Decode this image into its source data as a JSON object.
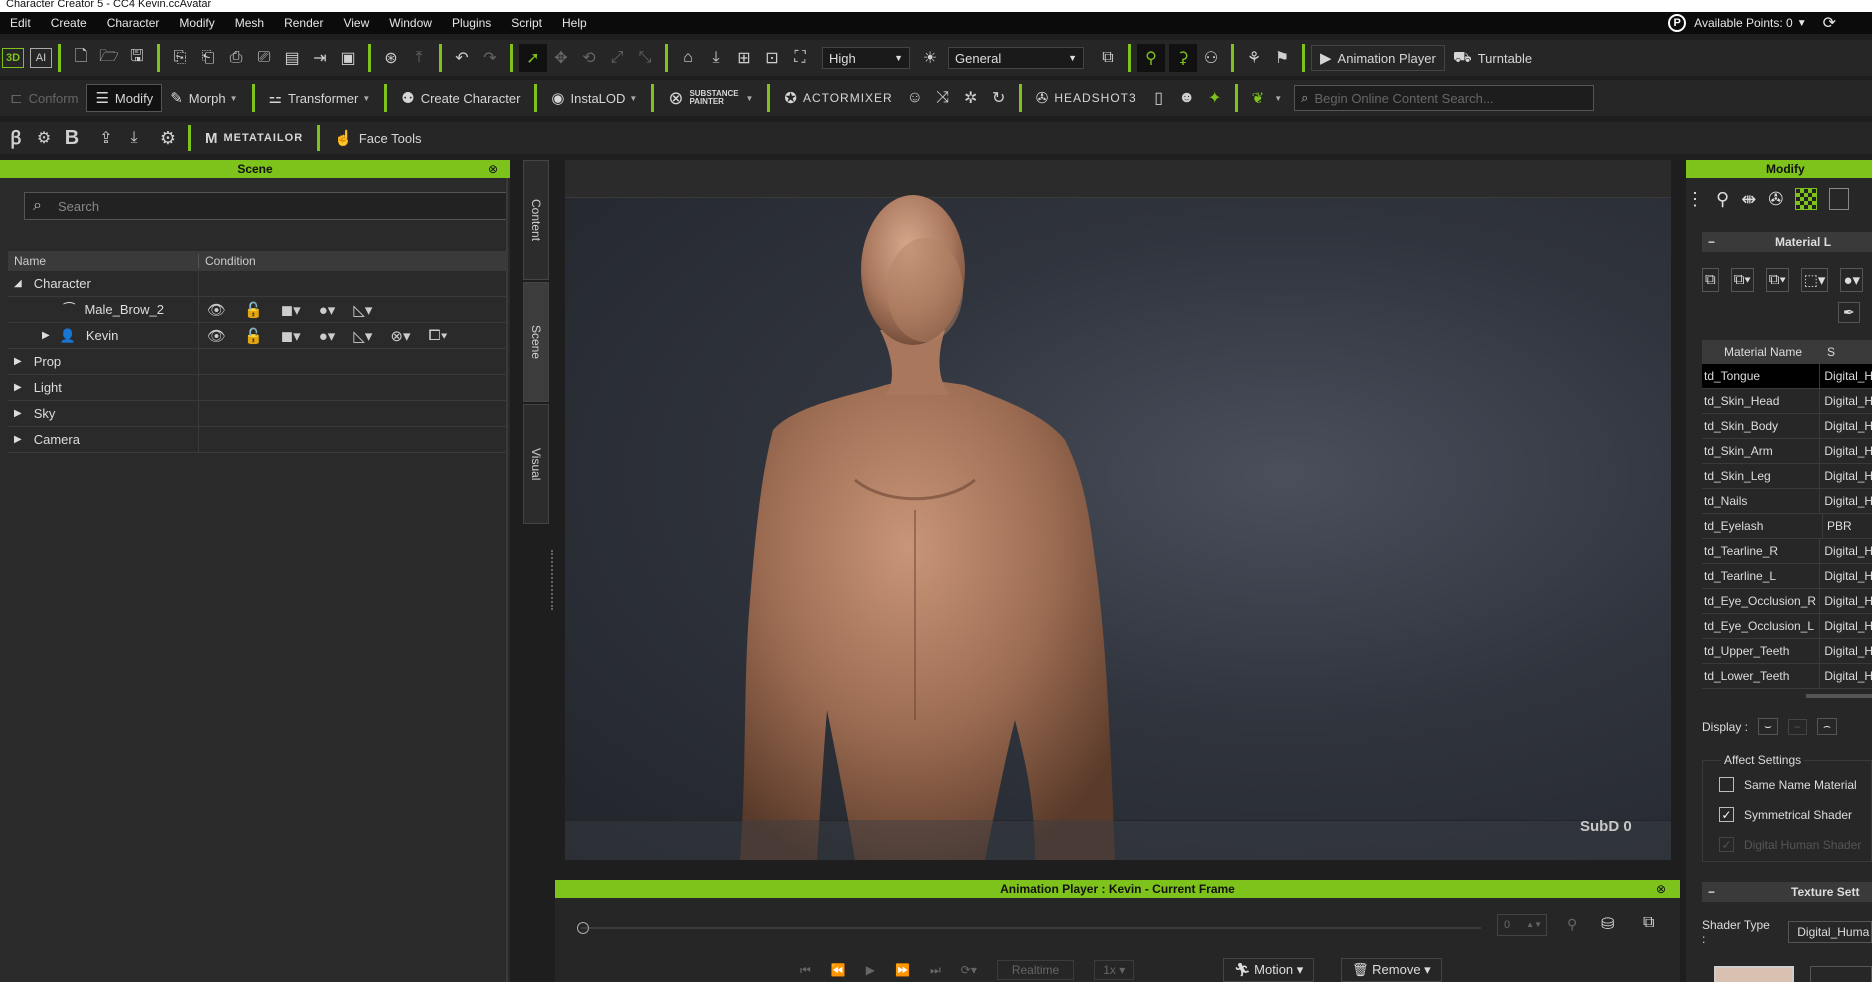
{
  "titlebar": {
    "text": "Character Creator 5 - CC4 Kevin.ccAvatar"
  },
  "menu": [
    "Edit",
    "Create",
    "Character",
    "Modify",
    "Mesh",
    "Render",
    "View",
    "Window",
    "Plugins",
    "Script",
    "Help"
  ],
  "account": {
    "points_label": "Available Points: 0"
  },
  "toolbar1": {
    "quality": "High",
    "render_mode": "General",
    "animation_player": "Animation Player",
    "turntable": "Turntable"
  },
  "toolbar2": {
    "conform": "Conform",
    "modify": "Modify",
    "morph": "Morph",
    "transformer": "Transformer",
    "create_character": "Create Character",
    "instalod": "InstaLOD",
    "substance": "SUBSTANCE PAINTER",
    "actormixer": "ACTORMIXER",
    "headshot": "HEADSHOT3",
    "search_placeholder": "Begin Online Content Search..."
  },
  "toolbar3": {
    "metatailor": "METATAILOR",
    "face_tools": "Face Tools"
  },
  "scene": {
    "title": "Scene",
    "search_placeholder": "Search",
    "col_name": "Name",
    "col_condition": "Condition",
    "rows": [
      {
        "name": "Character"
      },
      {
        "name": "Male_Brow_2"
      },
      {
        "name": "Kevin"
      },
      {
        "name": "Prop"
      },
      {
        "name": "Light"
      },
      {
        "name": "Sky"
      },
      {
        "name": "Camera"
      }
    ]
  },
  "side_tabs": [
    "Content",
    "Scene",
    "Visual"
  ],
  "viewport": {
    "subd": "SubD 0"
  },
  "anim": {
    "title": "Animation Player : Kevin - Current Frame",
    "frame": "0",
    "realtime": "Realtime",
    "speed": "1x",
    "motion": "Motion",
    "remove": "Remove"
  },
  "modify": {
    "title": "Modify",
    "material_header": "Material L",
    "col_material": "Material Name",
    "col_shader": "S",
    "materials": [
      {
        "name": "td_Tongue",
        "shader": "Digital_H"
      },
      {
        "name": "td_Skin_Head",
        "shader": "Digital_H"
      },
      {
        "name": "td_Skin_Body",
        "shader": "Digital_H"
      },
      {
        "name": "td_Skin_Arm",
        "shader": "Digital_H"
      },
      {
        "name": "td_Skin_Leg",
        "shader": "Digital_H"
      },
      {
        "name": "td_Nails",
        "shader": "Digital_H"
      },
      {
        "name": "td_Eyelash",
        "shader": "PBR"
      },
      {
        "name": "td_Tearline_R",
        "shader": "Digital_H"
      },
      {
        "name": "td_Tearline_L",
        "shader": "Digital_H"
      },
      {
        "name": "td_Eye_Occlusion_R",
        "shader": "Digital_H"
      },
      {
        "name": "td_Eye_Occlusion_L",
        "shader": "Digital_H"
      },
      {
        "name": "td_Upper_Teeth",
        "shader": "Digital_H"
      },
      {
        "name": "td_Lower_Teeth",
        "shader": "Digital_H"
      }
    ],
    "display_label": "Display :",
    "affect_settings": "Affect Settings",
    "same_name_material": "Same Name Material",
    "symmetrical_shader": "Symmetrical Shader",
    "digital_human_shader": "Digital Human Shader",
    "texture_header": "Texture Sett",
    "shader_type_label": "Shader Type :",
    "shader_type_value": "Digital_Huma"
  },
  "colors": {
    "accent": "#7ec21c"
  }
}
